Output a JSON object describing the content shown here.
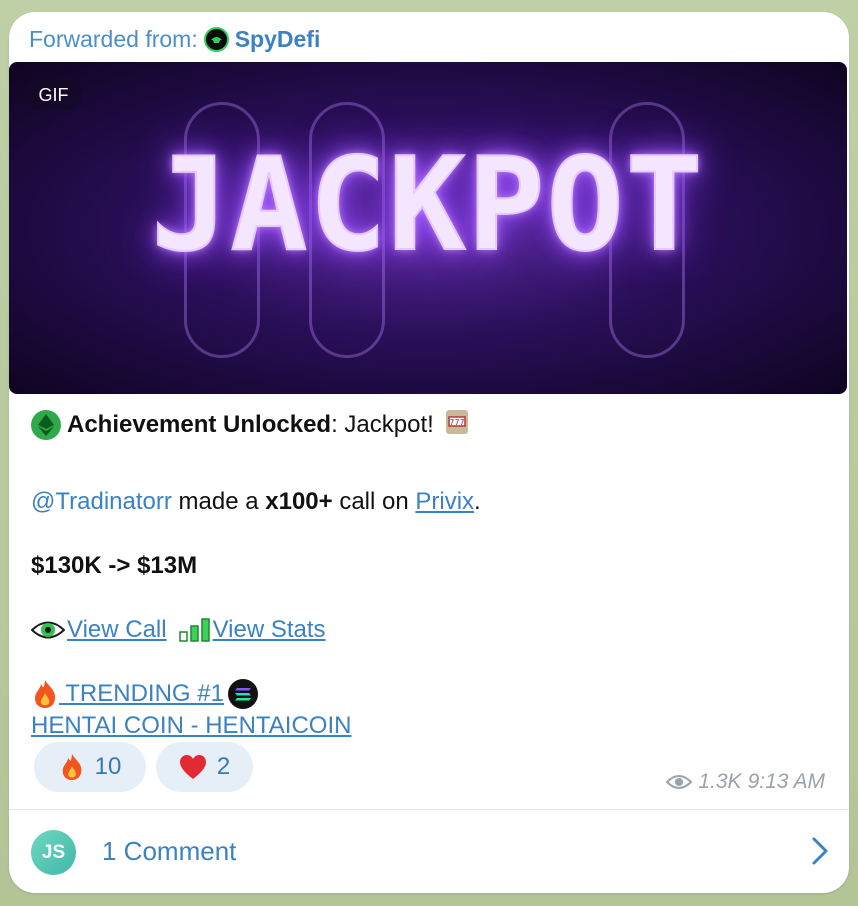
{
  "forward": {
    "prefix": "Forwarded from:",
    "channel": "SpyDefi",
    "avatar_icon": "spy-avatar-icon"
  },
  "media": {
    "badge": "GIF",
    "image_text": "JACKPOT"
  },
  "message": {
    "achievement_bold": "Achievement Unlocked",
    "achievement_rest": ": Jackpot!",
    "user_mention": "@Tradinatorr",
    "made_a": " made a ",
    "multiplier": "x100+",
    "call_on": " call on ",
    "token_link": "Privix",
    "period": ".",
    "price_move": "$130K -> $13M",
    "view_call": "View Call",
    "view_stats": "View Stats",
    "trending": " TRENDING #1",
    "trending_coin": "HENTAI COIN - HENTAICOIN"
  },
  "reactions": [
    {
      "emoji": "fire",
      "count": "10"
    },
    {
      "emoji": "heart",
      "count": "2"
    }
  ],
  "meta": {
    "views": "1.3K",
    "time": "9:13 AM"
  },
  "comments": {
    "avatar_initials": "JS",
    "label": "1 Comment"
  },
  "colors": {
    "link": "#3a82c1",
    "reaction_bg": "#e6eff8",
    "bubble_bg": "#ffffff",
    "chat_bg": "#b9c9a0"
  }
}
